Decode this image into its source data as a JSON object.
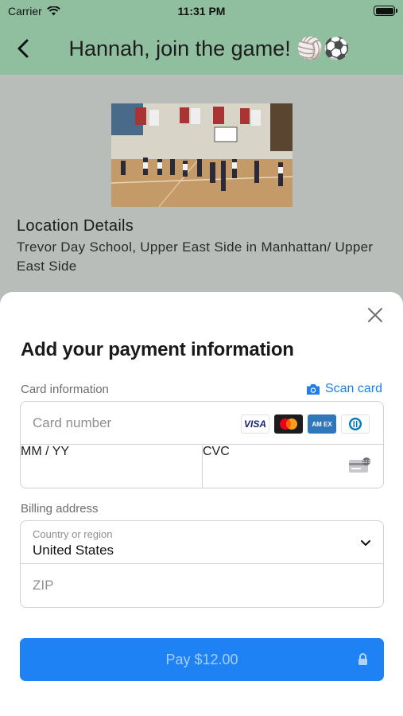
{
  "status_bar": {
    "carrier": "Carrier",
    "time": "11:31 PM",
    "icons": [
      "wifi-icon",
      "battery-icon"
    ]
  },
  "header": {
    "title": "Hannah, join the game!",
    "title_emoji": "🏐⚽",
    "back_icon": "chevron-left-icon",
    "background_color": "#8fbf9f"
  },
  "location": {
    "heading": "Location Details",
    "address": "Trevor Day School, Upper East Side in Manhattan/ Upper East Side"
  },
  "payment_sheet": {
    "title": "Add your payment information",
    "close_icon": "close-icon",
    "card_section_label": "Card information",
    "scan_card_label": "Scan card",
    "card_number_placeholder": "Card number",
    "expiry_placeholder": "MM / YY",
    "cvc_placeholder": "CVC",
    "card_brands": [
      "VISA",
      "Mastercard",
      "AMEX",
      "Diners Club"
    ],
    "amex_label": "AM EX",
    "billing_section_label": "Billing address",
    "country_label": "Country or region",
    "country_value": "United States",
    "zip_placeholder": "ZIP",
    "pay_button_label": "Pay $12.00",
    "accent_color": "#1f7fe6",
    "pay_button_color": "#1e82f5"
  }
}
